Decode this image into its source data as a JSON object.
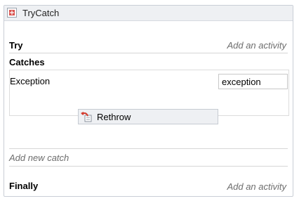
{
  "header": {
    "title": "TryCatch",
    "icon": "trycatch-icon"
  },
  "try": {
    "label": "Try",
    "hint": "Add an activity"
  },
  "catches": {
    "label": "Catches",
    "items": [
      {
        "exception_type": "Exception",
        "variable_name": "exception",
        "activity": "Rethrow",
        "activity_icon": "rethrow-icon"
      }
    ],
    "add_hint": "Add new catch"
  },
  "finally": {
    "label": "Finally",
    "hint": "Add an activity"
  }
}
